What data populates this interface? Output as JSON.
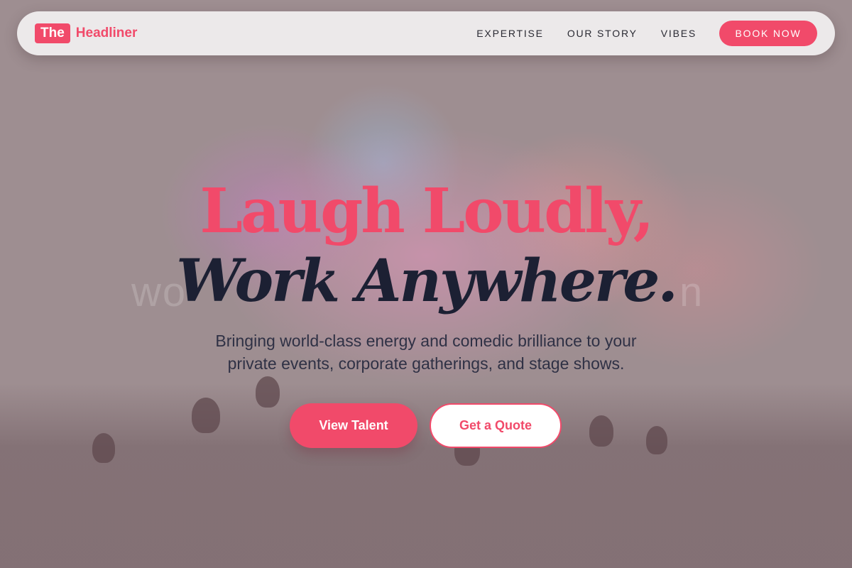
{
  "brand": {
    "badge": "The",
    "name": "Headliner"
  },
  "nav": {
    "links": [
      "EXPERTISE",
      "OUR STORY",
      "VIBES"
    ],
    "cta": "BOOK NOW"
  },
  "hero": {
    "line1": "Laugh Loudly,",
    "line2": "Work Anywhere.",
    "subtitle_line1": "Bringing world-class energy and comedic brilliance to your",
    "subtitle_line2": "private events, corporate gatherings, and stage shows."
  },
  "buttons": {
    "primary": "View Talent",
    "secondary": "Get a Quote"
  },
  "background": {
    "watermark_left": "wo",
    "watermark_right": "n"
  },
  "colors": {
    "accent": "#f14a6a",
    "heading_dark": "#1c2033",
    "nav_bg": "#ece9ea"
  }
}
